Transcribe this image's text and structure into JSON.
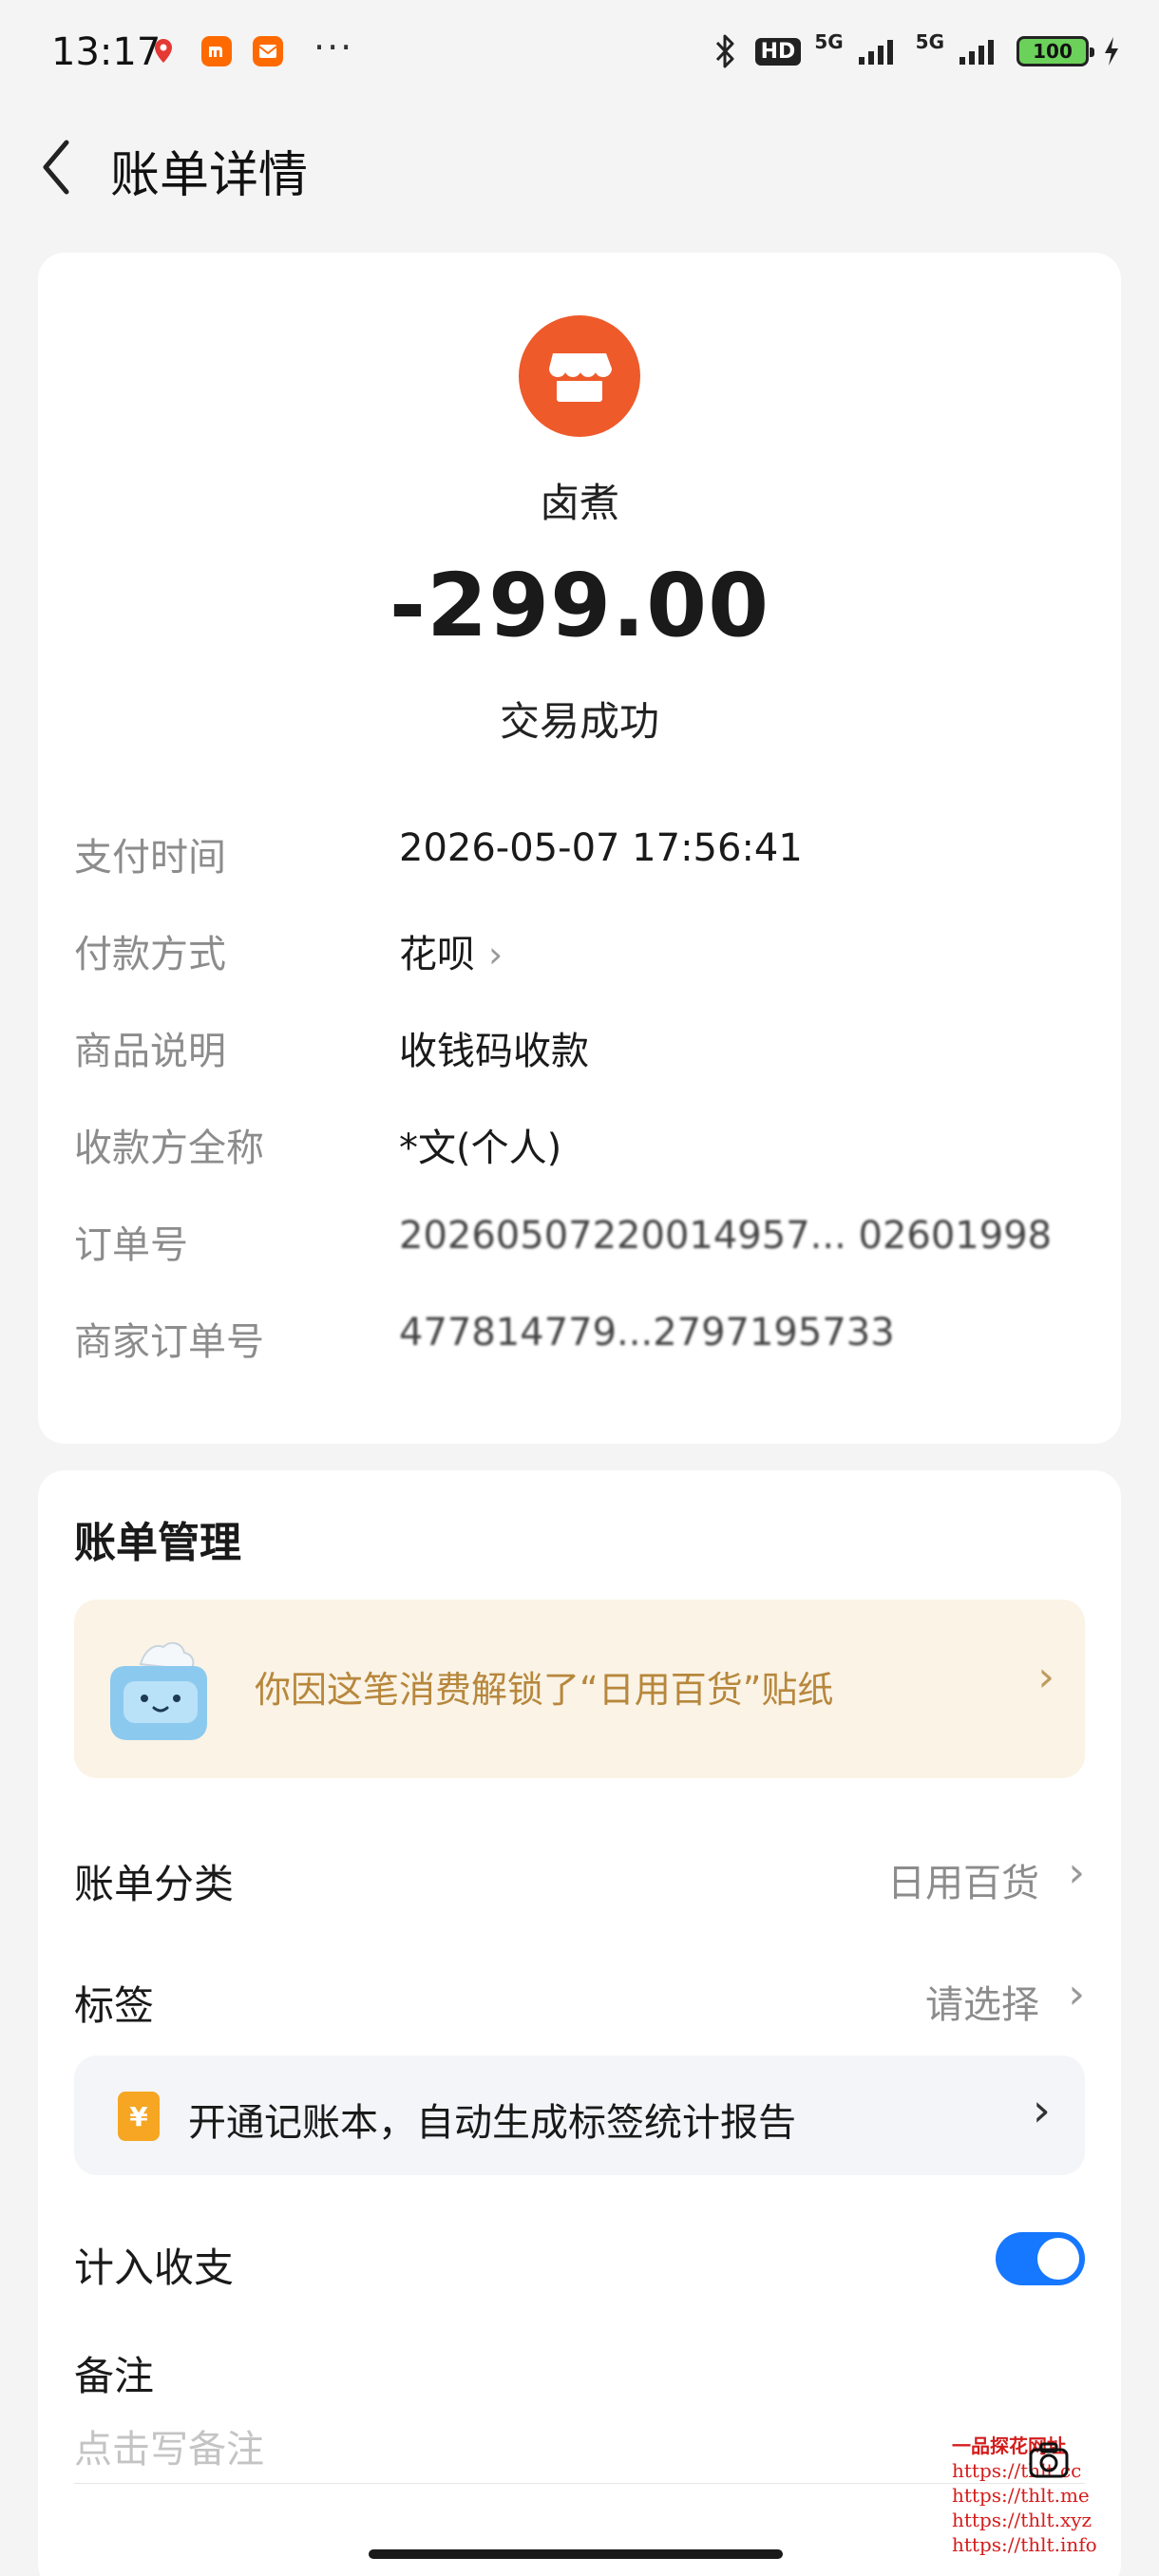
{
  "status_bar": {
    "time": "13:17",
    "more": "···",
    "hd": "HD",
    "net1": "5G",
    "net2": "5G",
    "battery": "100",
    "icons": [
      "map-pin-icon",
      "mi-icon",
      "mail-icon",
      "bluetooth-icon",
      "signal-icon",
      "charging-icon"
    ]
  },
  "header": {
    "title": "账单详情",
    "back_icon": "chevron-left-icon"
  },
  "transaction": {
    "merchant_icon": "store-icon",
    "merchant_icon_color": "#ee5a2a",
    "merchant": "卤煮",
    "amount": "-299.00",
    "status": "交易成功",
    "details": [
      {
        "label": "支付时间",
        "value": "2026-05-07 17:56:41"
      },
      {
        "label": "付款方式",
        "value": "花呗"
      },
      {
        "label": "商品说明",
        "value": "收钱码收款"
      },
      {
        "label": "收款方全称",
        "value": "*文(个人)"
      },
      {
        "label": "订单号",
        "value": "20260507220014957... 02601998"
      },
      {
        "label": "商家订单号",
        "value": "477814779...2797195733"
      }
    ]
  },
  "management": {
    "title": "账单管理",
    "sticker_banner": {
      "text": "你因这笔消费解锁了“日用百货”贴纸",
      "icon": "tissue-box-icon"
    },
    "category": {
      "label": "账单分类",
      "value": "日用百货"
    },
    "tag": {
      "label": "标签",
      "value": "请选择"
    },
    "promo": {
      "icon_text": "¥",
      "text": "开通记账本，自动生成标签统计报告"
    },
    "include": {
      "label": "计入收支",
      "enabled": true
    },
    "note": {
      "label": "备注",
      "placeholder": "点击写备注"
    }
  },
  "watermark": {
    "title": "一品探花网址",
    "links": [
      "https://thlt.cc",
      "https://thlt.me",
      "https://thlt.xyz",
      "https://thlt.info"
    ]
  },
  "colors": {
    "accent": "#1677ff",
    "merchant": "#ee5a2a",
    "sticker_bg": "#faf3e6",
    "sticker_text": "#b7873c"
  }
}
